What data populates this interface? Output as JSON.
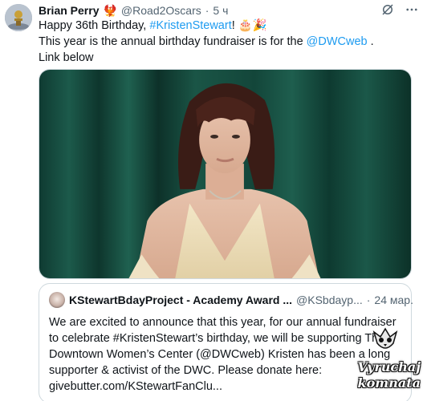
{
  "author": {
    "name": "Brian Perry",
    "emoji": "🐦‍🔥",
    "handle": "@Road2Oscars",
    "separator": "·",
    "time": "5 ч"
  },
  "icons": {
    "grok": "slash-circle-icon",
    "more": "more-horizontal-icon"
  },
  "tweet": {
    "line1_prefix": "Happy 36th Birthday, ",
    "line1_hashtag": "#KristenStewart",
    "line1_suffix": "! 🎂🎉",
    "line2_prefix": "This year is the annual birthday fundraiser is for the ",
    "line2_mention": "@DWCweb",
    "line2_suffix": " .",
    "line3": "Link below"
  },
  "media": {
    "alt": "photo"
  },
  "quote": {
    "name": "KStewartBdayProject - Academy Award ...",
    "handle": "@KSbdayp...",
    "separator": "·",
    "time": "24 мар.",
    "text": "We are excited to announce that this year, for our annual fundraiser to celebrate #KristenStewart’s birthday, we will be supporting The Downtown Women’s Center (@DWCweb) Kristen has been a long supporter & activist of the DWC. Please donate here: givebutter.com/KStewartFanClu..."
  },
  "watermark": {
    "line1": "Vyruchaj",
    "line2": "komnata"
  },
  "colors": {
    "link": "#1d9bf0",
    "secondary": "#536471",
    "border": "#cfd9de"
  }
}
